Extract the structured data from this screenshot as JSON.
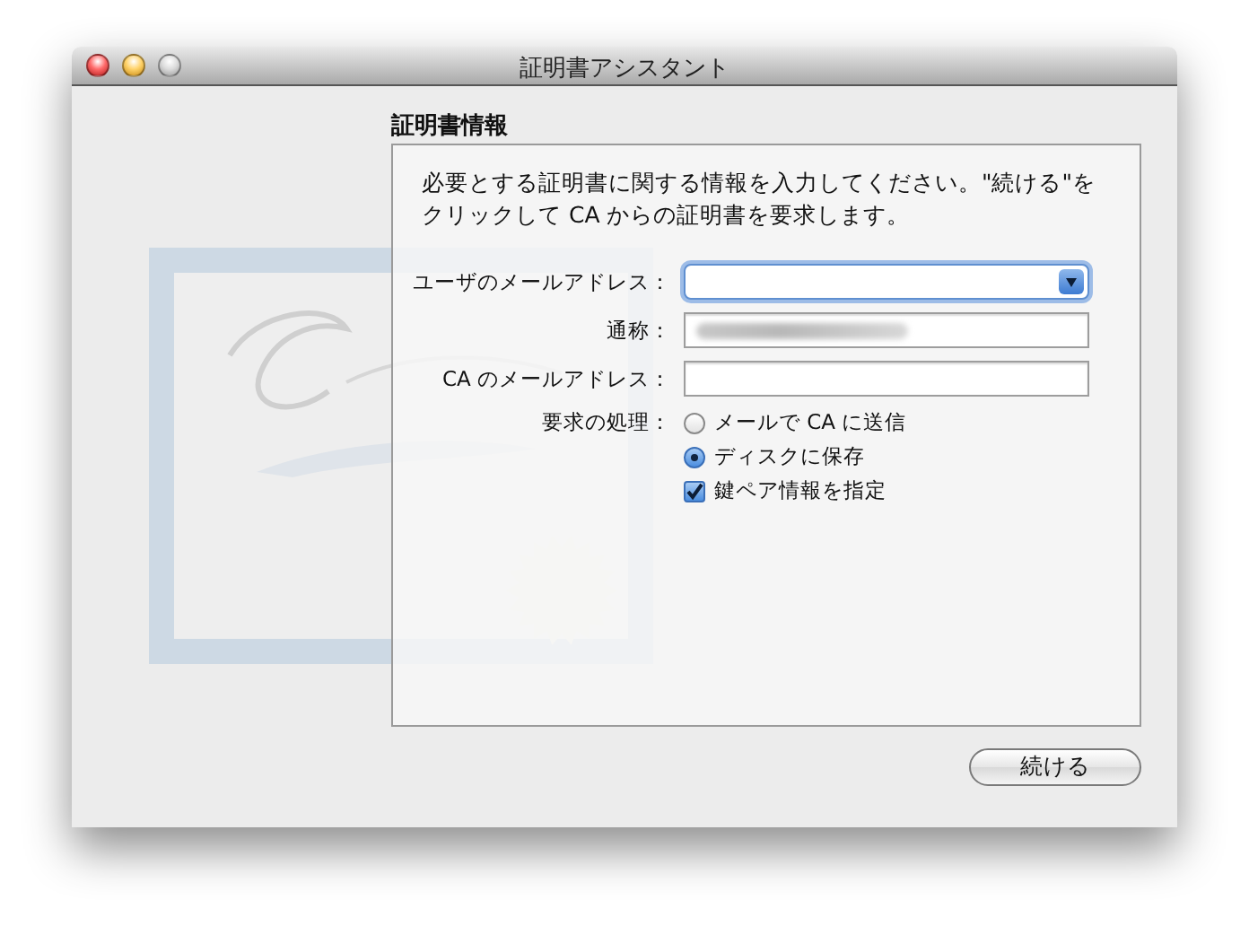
{
  "window": {
    "title": "証明書アシスタント"
  },
  "section_title": "証明書情報",
  "instructions": "必要とする証明書に関する情報を入力してください。\"続ける\"をクリックして CA からの証明書を要求します。",
  "fields": [
    {
      "label": "ユーザのメールアドレス：",
      "kind": "combo",
      "focused": true,
      "redacted": false
    },
    {
      "label": "通称：",
      "kind": "text",
      "focused": false,
      "redacted": true
    },
    {
      "label": "CA のメールアドレス：",
      "kind": "text",
      "focused": false,
      "redacted": false
    }
  ],
  "request": {
    "label": "要求の処理：",
    "options": [
      {
        "label": "メールで CA に送信",
        "selected": false
      },
      {
        "label": "ディスクに保存",
        "selected": true
      }
    ],
    "checkbox": {
      "label": "鍵ペア情報を指定",
      "checked": true
    }
  },
  "buttons": [
    {
      "label": "続ける"
    }
  ]
}
